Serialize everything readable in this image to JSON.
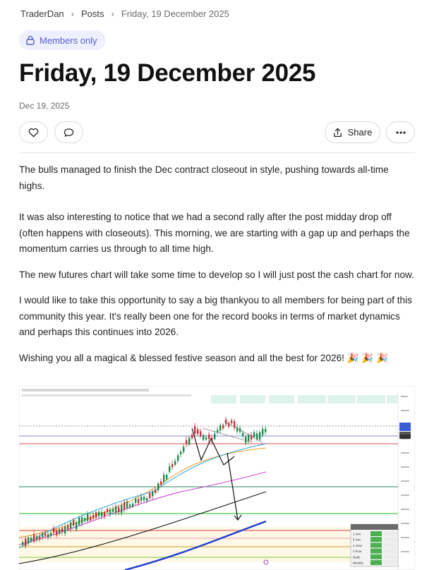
{
  "breadcrumb": {
    "items": [
      "TraderDan",
      "Posts",
      "Friday, 19 December 2025"
    ]
  },
  "badge": {
    "label": "Members only",
    "icon": "lock-icon"
  },
  "post": {
    "title": "Friday, 19 December 2025",
    "date": "Dec 19, 2025",
    "paragraphs": [
      "The bulls managed to finish the Dec contract closeout in style, pushing towards all-time highs.",
      "It was also interesting to notice that we had a second rally after the post midday drop off (often happens with closeouts). This morning, we are starting with a gap up and perhaps the momentum carries us through to all time high.",
      "The new futures chart will take some time to develop so I will just post the cash chart for now.",
      "I would like to take this opportunity to say a big thankyou to all members for being part of this community this year. It's really been one for the record books in terms of market dynamics and perhaps this continues into 2026.",
      "Wishing you all a magical & blessed festive season and all the best for 2026! 🎉 🎉 🎉"
    ]
  },
  "actions": {
    "like_icon": "heart-icon",
    "comment_icon": "comment-icon",
    "share_label": "Share",
    "share_icon": "share-icon",
    "more_icon": "more-icon"
  },
  "chart_image": {
    "type": "candlestick",
    "legend_table": {
      "rows": [
        "1 min",
        "5 min",
        "1 Hour",
        "4 hour",
        "Daily",
        "Weekly"
      ]
    }
  },
  "colors": {
    "badge_bg": "#eef0ff",
    "badge_text": "#5561c9",
    "up": "#1a8a4a",
    "down": "#c8303a"
  }
}
